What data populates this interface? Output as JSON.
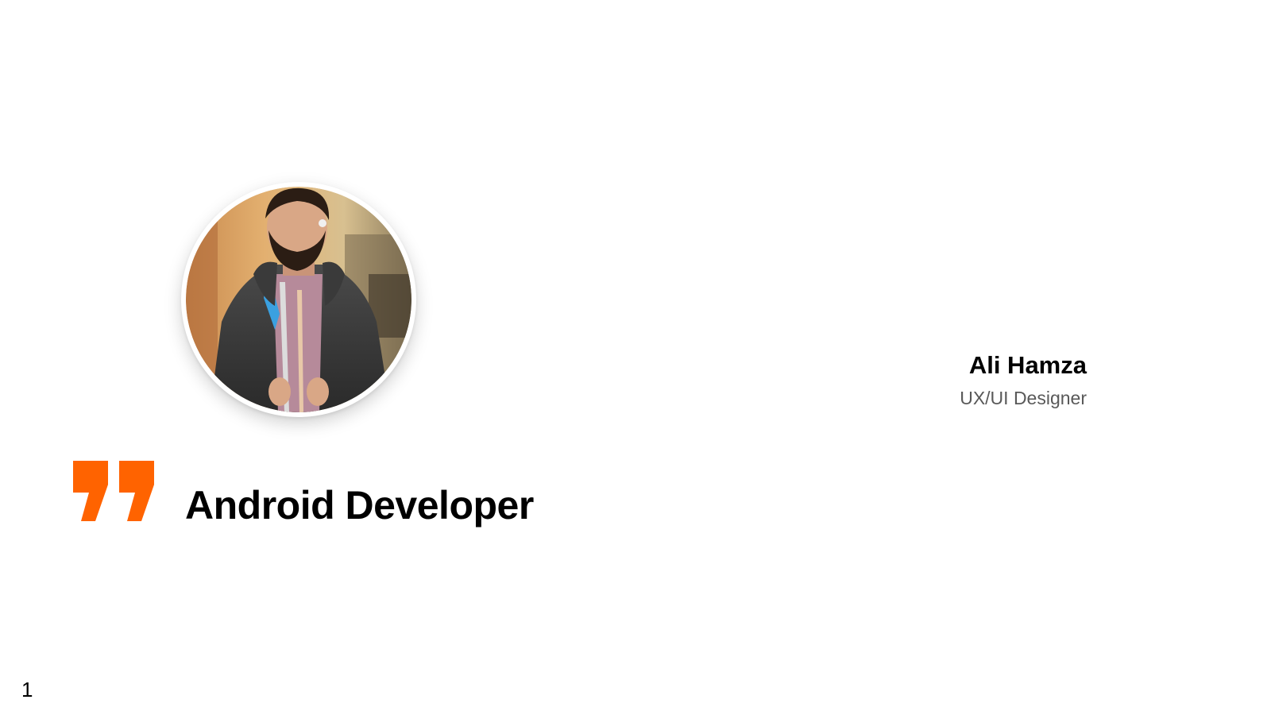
{
  "slide": {
    "headline": "Android Developer",
    "person": {
      "name": "Ali Hamza",
      "role": "UX/UI Designer"
    },
    "page_number": "1"
  },
  "icons": {
    "quote": "closing-quote-icon",
    "avatar": "profile-photo"
  },
  "colors": {
    "accent": "#FF6300",
    "text": "#000000",
    "secondary_text": "#595959",
    "background": "#FFFFFF"
  }
}
